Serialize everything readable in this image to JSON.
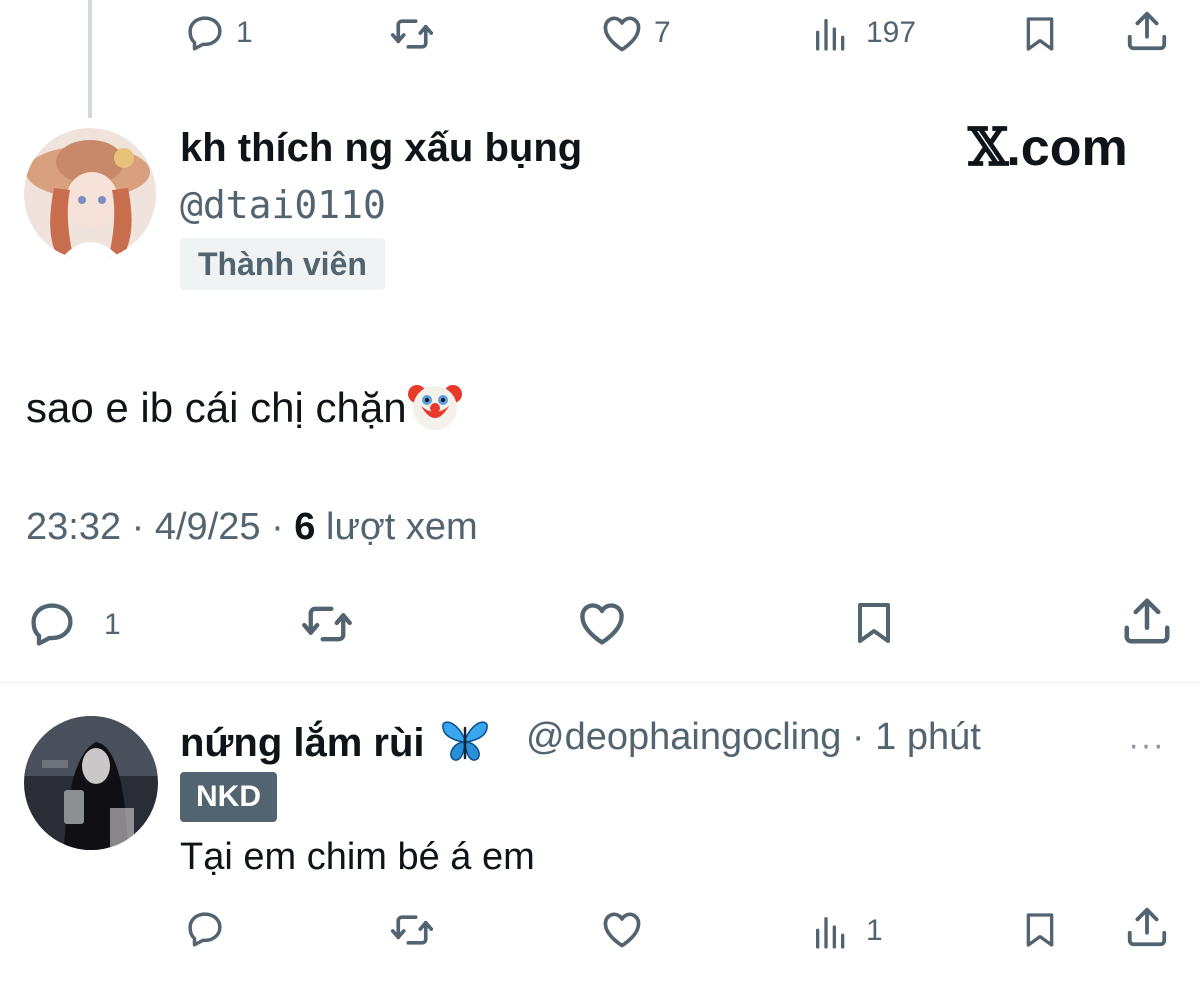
{
  "previous_tweet": {
    "reply_count": "1",
    "like_count": "7",
    "view_count": "197",
    "icons": [
      "reply-icon",
      "retweet-icon",
      "like-icon",
      "views-icon",
      "bookmark-icon",
      "share-icon"
    ]
  },
  "main_tweet": {
    "display_name": "kh thích ng xấu bụng",
    "handle": "@dtai0110",
    "badge": "Thành viên",
    "brand": {
      "x": "𝕏",
      "suffix": ".com"
    },
    "text": "sao e ib cái chị chặn",
    "emoji": "clown-face",
    "time": "23:32 · 4/9/25 · ",
    "views_number": "6",
    "views_label": " lượt xem",
    "reply_count": "1",
    "icons": [
      "reply-icon",
      "retweet-icon",
      "like-icon",
      "bookmark-icon",
      "share-icon"
    ]
  },
  "reply_tweet": {
    "display_name": "nứng lắm rùi",
    "emoji": "butterfly",
    "handle": "@deophaingocling",
    "time": " · 1 phút",
    "badge": "NKD",
    "text": "Tại em chim bé á em",
    "view_count": "1",
    "more": "···",
    "icons": [
      "reply-icon",
      "retweet-icon",
      "like-icon",
      "views-icon",
      "bookmark-icon",
      "share-icon"
    ]
  },
  "colors": {
    "text_primary": "#0f1419",
    "text_secondary": "#536471",
    "badge_light_bg": "#eff3f4",
    "badge_dark_bg": "#536471",
    "thread_line": "#cfd9de"
  }
}
